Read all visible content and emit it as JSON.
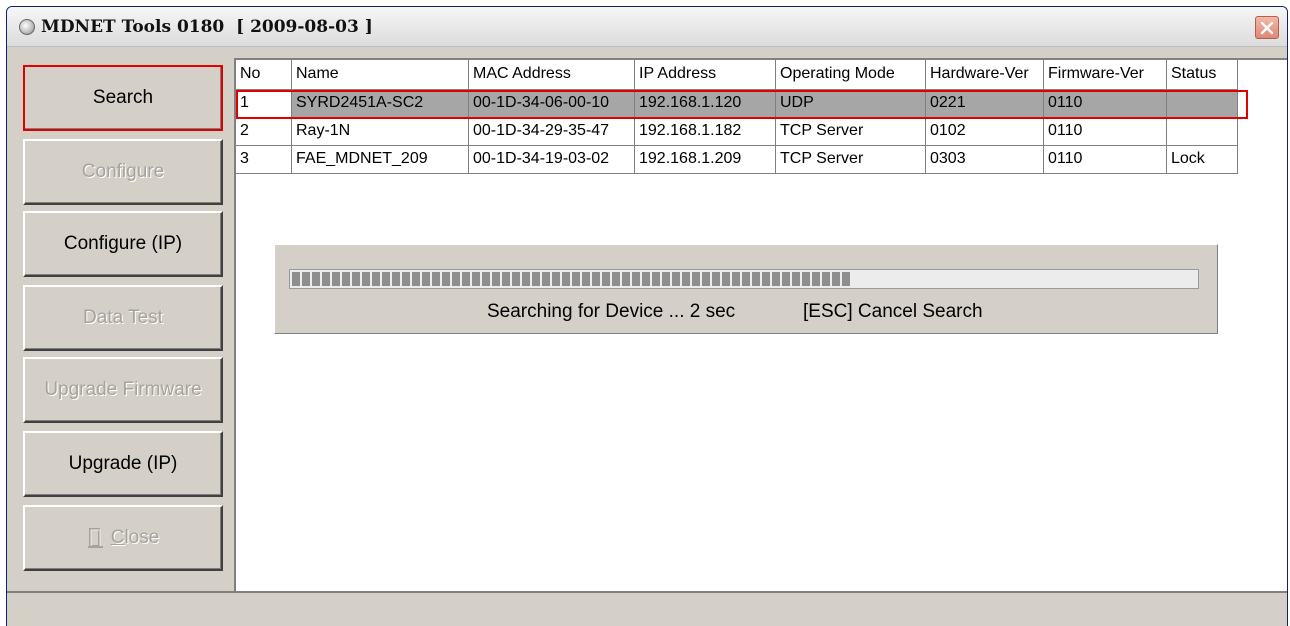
{
  "window": {
    "title": "MDNET Tools 0180  [ 2009-08-03 ]"
  },
  "buttons": {
    "search": "Search",
    "configure": "Configure",
    "configure_ip": "Configure (IP)",
    "data_test": "Data Test",
    "upgrade_firmware": "Upgrade Firmware",
    "upgrade_ip": "Upgrade (IP)",
    "close_prefix": "",
    "close_u": "C",
    "close_rest": "lose"
  },
  "table": {
    "columns": [
      "No",
      "Name",
      "MAC Address",
      "IP Address",
      "Operating Mode",
      "Hardware-Ver",
      "Firmware-Ver",
      "Status"
    ],
    "rows": [
      {
        "no": "1",
        "name": "SYRD2451A-SC2",
        "mac": "00-1D-34-06-00-10",
        "ip": "192.168.1.120",
        "mode": "UDP",
        "hw": "0221",
        "fw": "0110",
        "status": ""
      },
      {
        "no": "2",
        "name": "Ray-1N",
        "mac": "00-1D-34-29-35-47",
        "ip": "192.168.1.182",
        "mode": "TCP Server",
        "hw": "0102",
        "fw": "0110",
        "status": ""
      },
      {
        "no": "3",
        "name": "FAE_MDNET_209",
        "mac": "00-1D-34-19-03-02",
        "ip": "192.168.1.209",
        "mode": "TCP Server",
        "hw": "0303",
        "fw": "0110",
        "status": "Lock"
      }
    ]
  },
  "progress": {
    "fraction": 0.62,
    "message": "Searching for Device ... 2 sec",
    "cancel_hint": "[ESC] Cancel Search"
  },
  "colors": {
    "selection_highlight": "#e00000",
    "selected_row": "#a6a6a6"
  }
}
